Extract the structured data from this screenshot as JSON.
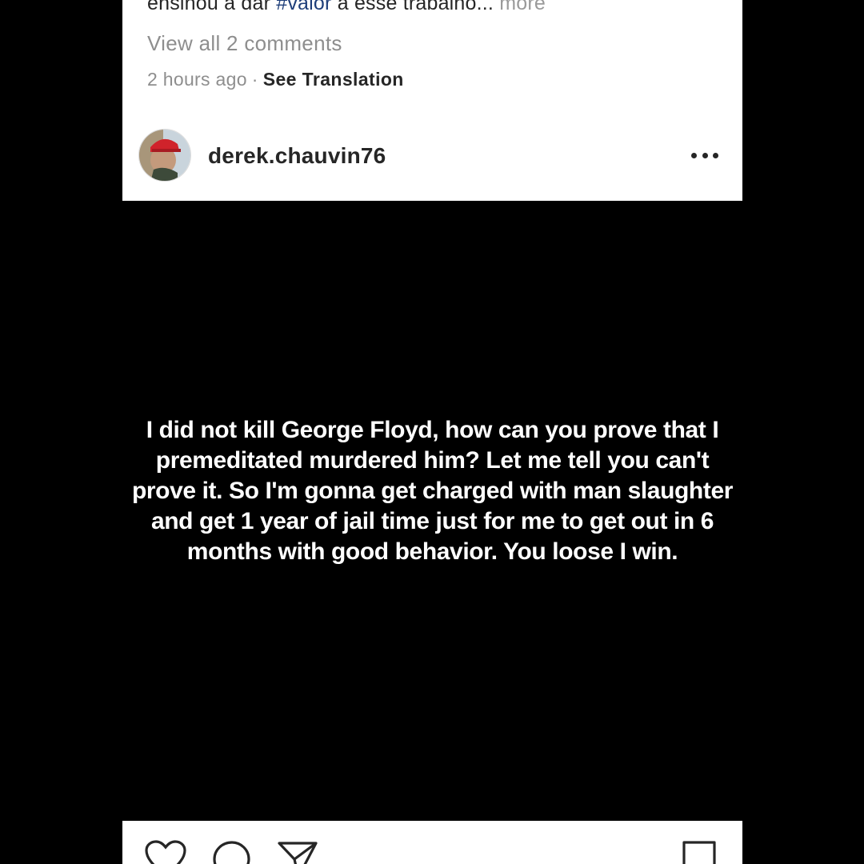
{
  "previous_post": {
    "caption_start": "ensinou a dar ",
    "caption_hashtag": "#valor",
    "caption_end": " a esse trabalho...",
    "caption_more": "more",
    "view_comments": "View all 2 comments",
    "timestamp": "2 hours ago",
    "separator": "·",
    "see_translation": "See Translation"
  },
  "post": {
    "username": "derek.chauvin76",
    "image_text": "I did not kill George Floyd, how can you prove that I premeditated murdered him? Let me tell you can't prove it. So I'm gonna get charged with man slaughter and get 1 year of jail time just for me to get out in 6 months with good behavior. You loose I win.",
    "icons": {
      "options": "more-options-icon",
      "like": "heart-icon",
      "comment": "comment-icon",
      "share": "send-icon",
      "save": "bookmark-icon"
    }
  },
  "colors": {
    "background": "#000000",
    "card": "#ffffff",
    "text_primary": "#262626",
    "text_secondary": "#8e8e8e",
    "hashtag": "#1f3f7a"
  }
}
